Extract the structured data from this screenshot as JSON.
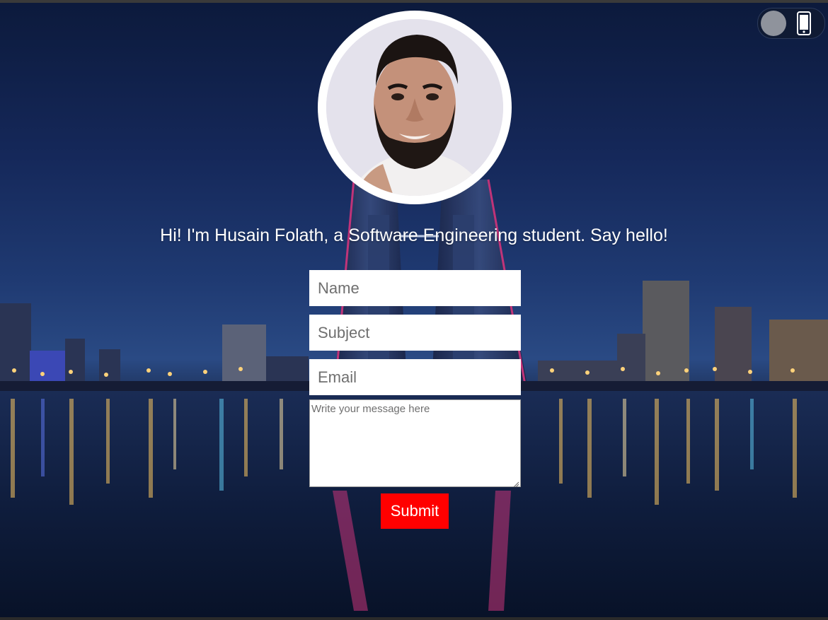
{
  "header": {
    "theme_toggle": {
      "icon": "mobile-phone-icon",
      "knob_color": "#8f939c",
      "track_color": "#0f1a33"
    }
  },
  "profile": {
    "avatar_icon": "profile-photo",
    "greeting": "Hi! I'm Husain Folath, a Software Engineering student. Say hello!"
  },
  "form": {
    "name": {
      "placeholder": "Name",
      "value": ""
    },
    "subject": {
      "placeholder": "Subject",
      "value": ""
    },
    "email": {
      "placeholder": "Email",
      "value": ""
    },
    "message": {
      "placeholder": "Write your message here",
      "value": ""
    },
    "submit_label": "Submit"
  },
  "colors": {
    "accent": "#ff0000",
    "text": "#ffffff",
    "field_background": "#ffffff"
  }
}
